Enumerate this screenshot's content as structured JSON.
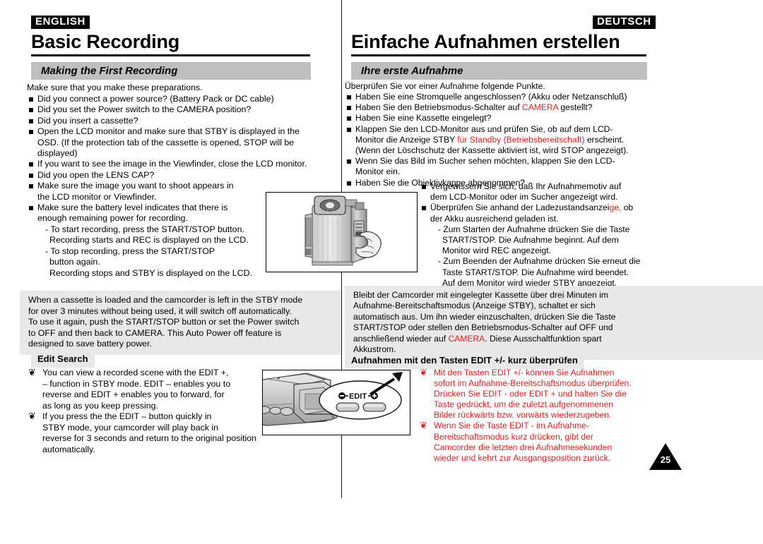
{
  "english": {
    "lang_tag": "ENGLISH",
    "title": "Basic Recording",
    "section_header": "Making the First Recording",
    "lead": "Make sure that you make these preparations.",
    "checklist": [
      {
        "type": "bullet",
        "text": "Did you connect a power source? (Battery Pack or DC cable)"
      },
      {
        "type": "bullet",
        "text": "Did you set the Power switch to the CAMERA position?"
      },
      {
        "type": "bullet",
        "text": "Did you insert a cassette?"
      },
      {
        "type": "bullet",
        "text": "Open the LCD monitor and make sure that STBY is displayed in the"
      },
      {
        "type": "cont",
        "text": "OSD. (If the protection tab of the cassette is opened, STOP will be"
      },
      {
        "type": "cont",
        "text": "displayed)"
      },
      {
        "type": "bullet",
        "text": "If you want to see the image in the Viewfinder, close the LCD monitor."
      },
      {
        "type": "bullet",
        "text": "Did you open the LENS CAP?"
      },
      {
        "type": "bullet",
        "text": "Make sure the image you want to shoot appears in"
      },
      {
        "type": "cont",
        "text": "the LCD monitor or Viewfinder."
      },
      {
        "type": "bullet",
        "text": "Make sure the battery level indicates that there is"
      },
      {
        "type": "cont",
        "text": "enough remaining power for recording."
      },
      {
        "type": "dash",
        "text": "- To start recording, press the START/STOP button."
      },
      {
        "type": "dash2",
        "text": "Recording starts and REC is displayed on the LCD."
      },
      {
        "type": "dash",
        "text": "- To stop recording, press the START/STOP"
      },
      {
        "type": "dash2",
        "text": "button again."
      },
      {
        "type": "dash2",
        "text": "Recording stops and STBY is displayed on the LCD."
      }
    ],
    "note": "When a cassette is loaded and the camcorder is left in the STBY mode\nfor over 3 minutes without being used, it will switch off automatically.\nTo use it again, push the START/STOP button or set the Power switch\nto OFF and then back to CAMERA. This Auto Power off feature is\ndesigned to save battery power.",
    "sub_label": "Edit Search",
    "edit_search": [
      {
        "type": "diamond",
        "text": "You can view a recorded scene with the EDIT +,"
      },
      {
        "type": "cont",
        "text": "– function in STBY mode. EDIT – enables you to"
      },
      {
        "type": "cont",
        "text": "reverse and EDIT + enables you to forward, for"
      },
      {
        "type": "cont",
        "text": "as long as you keep pressing."
      },
      {
        "type": "diamond",
        "text": "If you press the the EDIT – button quickly in"
      },
      {
        "type": "cont",
        "text": "STBY mode, your camcorder will play back in"
      },
      {
        "type": "cont",
        "text": "reverse for 3 seconds and return to the original position"
      },
      {
        "type": "cont",
        "text": "automatically."
      }
    ]
  },
  "german": {
    "lang_tag": "DEUTSCH",
    "title": "Einfache Aufnahmen erstellen",
    "section_header": "Ihre erste Aufnahme",
    "lead": "Überprüfen Sie vor einer Aufnahme folgende Punkte.",
    "checklist": [
      {
        "type": "bullet",
        "segments": [
          {
            "text": "Haben Sie eine Stromquelle angeschlossen? (Akku oder Netzanschluß)",
            "color": "black"
          }
        ]
      },
      {
        "type": "bullet",
        "segments": [
          {
            "text": "Haben Sie den Betriebsmodus-Schalter auf ",
            "color": "black"
          },
          {
            "text": "CAMERA",
            "color": "red"
          },
          {
            "text": " gestellt?",
            "color": "black"
          }
        ]
      },
      {
        "type": "bullet",
        "segments": [
          {
            "text": "Haben Sie eine Kassette eingelegt?",
            "color": "black"
          }
        ]
      },
      {
        "type": "bullet",
        "segments": [
          {
            "text": "Klappen Sie den LCD-Monitor aus und prüfen Sie, ob auf dem LCD-",
            "color": "black"
          }
        ]
      },
      {
        "type": "cont",
        "segments": [
          {
            "text": "Monitor die Anzeige STBY ",
            "color": "black"
          },
          {
            "text": "für Standby (Betriebsbereitschaft)",
            "color": "red"
          },
          {
            "text": " erscheint.",
            "color": "black"
          }
        ]
      },
      {
        "type": "cont",
        "segments": [
          {
            "text": "(Wenn der Löschschutz der Kassette aktiviert ist, wird STOP angezeigt).",
            "color": "black"
          }
        ]
      },
      {
        "type": "bullet",
        "segments": [
          {
            "text": "Wenn Sie das Bild im Sucher sehen möchten, klappen Sie den LCD-",
            "color": "black"
          }
        ]
      },
      {
        "type": "cont",
        "segments": [
          {
            "text": "Monitor ein.",
            "color": "black"
          }
        ]
      },
      {
        "type": "bullet",
        "segments": [
          {
            "text": "Haben Sie die Objektivkappe abgenommen?",
            "color": "black"
          }
        ]
      }
    ],
    "sub_checklist": [
      {
        "type": "bullet",
        "segments": [
          {
            "text": "Vergewissern Sie sich, daß Ihr Aufnahmemotiv auf",
            "color": "black"
          }
        ]
      },
      {
        "type": "cont",
        "segments": [
          {
            "text": "dem LCD-Monitor oder im Sucher angezeigt wird.",
            "color": "black"
          }
        ]
      },
      {
        "type": "bullet",
        "segments": [
          {
            "text": "Überprüfen Sie anhand der Ladezustandsanzei",
            "color": "black"
          },
          {
            "text": "ge,",
            "color": "red"
          },
          {
            "text": " ob",
            "color": "black"
          }
        ]
      },
      {
        "type": "cont",
        "segments": [
          {
            "text": "der Akku ausreichend geladen ist.",
            "color": "black"
          }
        ]
      },
      {
        "type": "dash",
        "segments": [
          {
            "text": "- Zum Starten der Aufnahme drücken Sie die Taste",
            "color": "black"
          }
        ]
      },
      {
        "type": "dash2",
        "segments": [
          {
            "text": "START/STOP. Die Aufnahme beginnt. Auf dem",
            "color": "black"
          }
        ]
      },
      {
        "type": "dash2",
        "segments": [
          {
            "text": "Monitor wird REC angezeigt.",
            "color": "black"
          }
        ]
      },
      {
        "type": "dash",
        "segments": [
          {
            "text": "- Zum Beenden der Aufnahme drücken Sie erneut die",
            "color": "black"
          }
        ]
      },
      {
        "type": "dash2",
        "segments": [
          {
            "text": "Taste START/STOP. Die Aufnahme wird beendet.",
            "color": "black"
          }
        ]
      },
      {
        "type": "dash2",
        "segments": [
          {
            "text": "Auf dem Monitor wird wieder STBY angezeigt.",
            "color": "black"
          }
        ]
      }
    ],
    "note_lines": [
      [
        {
          "text": "Bleibt der Camcorder mit eingelegter Kassette über drei Minuten im",
          "color": "black"
        }
      ],
      [
        {
          "text": "Aufnahme-Bereitschaftsmodus (Anzeige STBY), schaltet er sich",
          "color": "black"
        }
      ],
      [
        {
          "text": "automatisch aus. Um ihn wieder einzuschalten, drücken Sie die Taste",
          "color": "black"
        }
      ],
      [
        {
          "text": "START/STOP oder stellen den Betriebsmodus-Schalter auf OFF und",
          "color": "black"
        }
      ],
      [
        {
          "text": "anschließend wieder auf ",
          "color": "black"
        },
        {
          "text": "CAMERA",
          "color": "red"
        },
        {
          "text": ". Diese Ausschaltfunktion spart",
          "color": "black"
        }
      ],
      [
        {
          "text": "Akkustrom.",
          "color": "black"
        }
      ]
    ],
    "sub_label": "Aufnahmen mit den Tasten EDIT +/- kurz überprüfen",
    "edit_search": [
      {
        "type": "diamond",
        "text": "Mit den Tasten EDIT +/- können Sie Aufnahmen"
      },
      {
        "type": "cont",
        "text": "sofort im Aufnahme-Bereitschaftsmodus überprüfen."
      },
      {
        "type": "cont",
        "text": "Drücken Sie EDIT - oder EDIT + und halten Sie die"
      },
      {
        "type": "cont",
        "text": "Taste gedrückt, um die zuletzt aufgenommenen"
      },
      {
        "type": "cont",
        "text": "Bilder rückwärts bzw. vorwärts wiederzugeben."
      },
      {
        "type": "diamond",
        "text": "Wenn Sie die Taste EDIT - im Aufnahme-"
      },
      {
        "type": "cont",
        "text": "Bereitschaftsmodus kurz drücken, gibt der"
      },
      {
        "type": "cont",
        "text": "Camcorder die letzten drei Aufnahmesekunden"
      },
      {
        "type": "cont",
        "text": "wieder und kehrt zur Ausgangsposition zurück."
      }
    ]
  },
  "figures": {
    "recording": {
      "caption": "camcorder with hand pressing START/STOP button"
    },
    "edit": {
      "caption": "camcorder rear with EDIT minus / plus buttons callout",
      "label": "EDIT",
      "minus": "⊖",
      "plus": "⊕"
    }
  },
  "page_number": "25",
  "colors": {
    "accent_red": "#ff1414",
    "section_header_bg": "#bfbfbf",
    "note_bg": "#e8e8e8",
    "text": "#000000"
  }
}
